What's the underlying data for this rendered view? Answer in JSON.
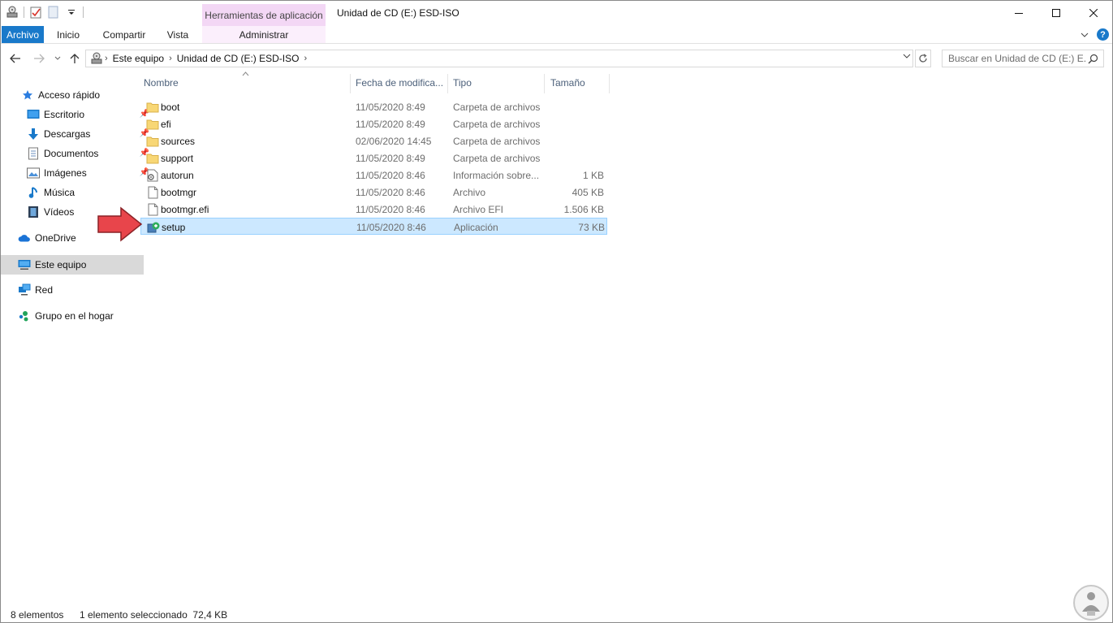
{
  "window": {
    "title": "Unidad de CD (E:) ESD-ISO",
    "context_tab_group": "Herramientas de aplicación"
  },
  "ribbon": {
    "tabs": [
      "Archivo",
      "Inicio",
      "Compartir",
      "Vista"
    ],
    "context_tab": "Administrar"
  },
  "address": {
    "crumbs": [
      "Este equipo",
      "Unidad de CD (E:) ESD-ISO"
    ]
  },
  "search": {
    "placeholder": "Buscar en Unidad de CD (E:) E..."
  },
  "nav": {
    "quick_access": "Acceso rápido",
    "pinned": [
      {
        "label": "Escritorio",
        "icon": "desktop-icon"
      },
      {
        "label": "Descargas",
        "icon": "download-icon"
      },
      {
        "label": "Documentos",
        "icon": "documents-icon"
      },
      {
        "label": "Imágenes",
        "icon": "pictures-icon"
      }
    ],
    "music": "Música",
    "videos": "Vídeos",
    "onedrive": "OneDrive",
    "this_pc": "Este equipo",
    "network": "Red",
    "homegroup": "Grupo en el hogar"
  },
  "columns": {
    "name": "Nombre",
    "date": "Fecha de modifica...",
    "type": "Tipo",
    "size": "Tamaño"
  },
  "files": [
    {
      "name": "boot",
      "date": "11/05/2020 8:49",
      "type": "Carpeta de archivos",
      "size": "",
      "icon": "folder-icon"
    },
    {
      "name": "efi",
      "date": "11/05/2020 8:49",
      "type": "Carpeta de archivos",
      "size": "",
      "icon": "folder-icon"
    },
    {
      "name": "sources",
      "date": "02/06/2020 14:45",
      "type": "Carpeta de archivos",
      "size": "",
      "icon": "folder-icon"
    },
    {
      "name": "support",
      "date": "11/05/2020 8:49",
      "type": "Carpeta de archivos",
      "size": "",
      "icon": "folder-icon"
    },
    {
      "name": "autorun",
      "date": "11/05/2020 8:46",
      "type": "Información sobre...",
      "size": "1 KB",
      "icon": "settings-file-icon"
    },
    {
      "name": "bootmgr",
      "date": "11/05/2020 8:46",
      "type": "Archivo",
      "size": "405 KB",
      "icon": "file-icon"
    },
    {
      "name": "bootmgr.efi",
      "date": "11/05/2020 8:46",
      "type": "Archivo EFI",
      "size": "1.506 KB",
      "icon": "file-icon"
    },
    {
      "name": "setup",
      "date": "11/05/2020 8:46",
      "type": "Aplicación",
      "size": "73 KB",
      "icon": "setup-app-icon"
    }
  ],
  "status": {
    "count": "8 elementos",
    "selection": "1 elemento seleccionado  72,4 KB"
  },
  "colors": {
    "accent": "#1979ca",
    "context_tab": "#f3d7f5",
    "selection_bg": "#cce8ff",
    "selection_border": "#99d1ff",
    "annotation_arrow": "#e8454b"
  }
}
